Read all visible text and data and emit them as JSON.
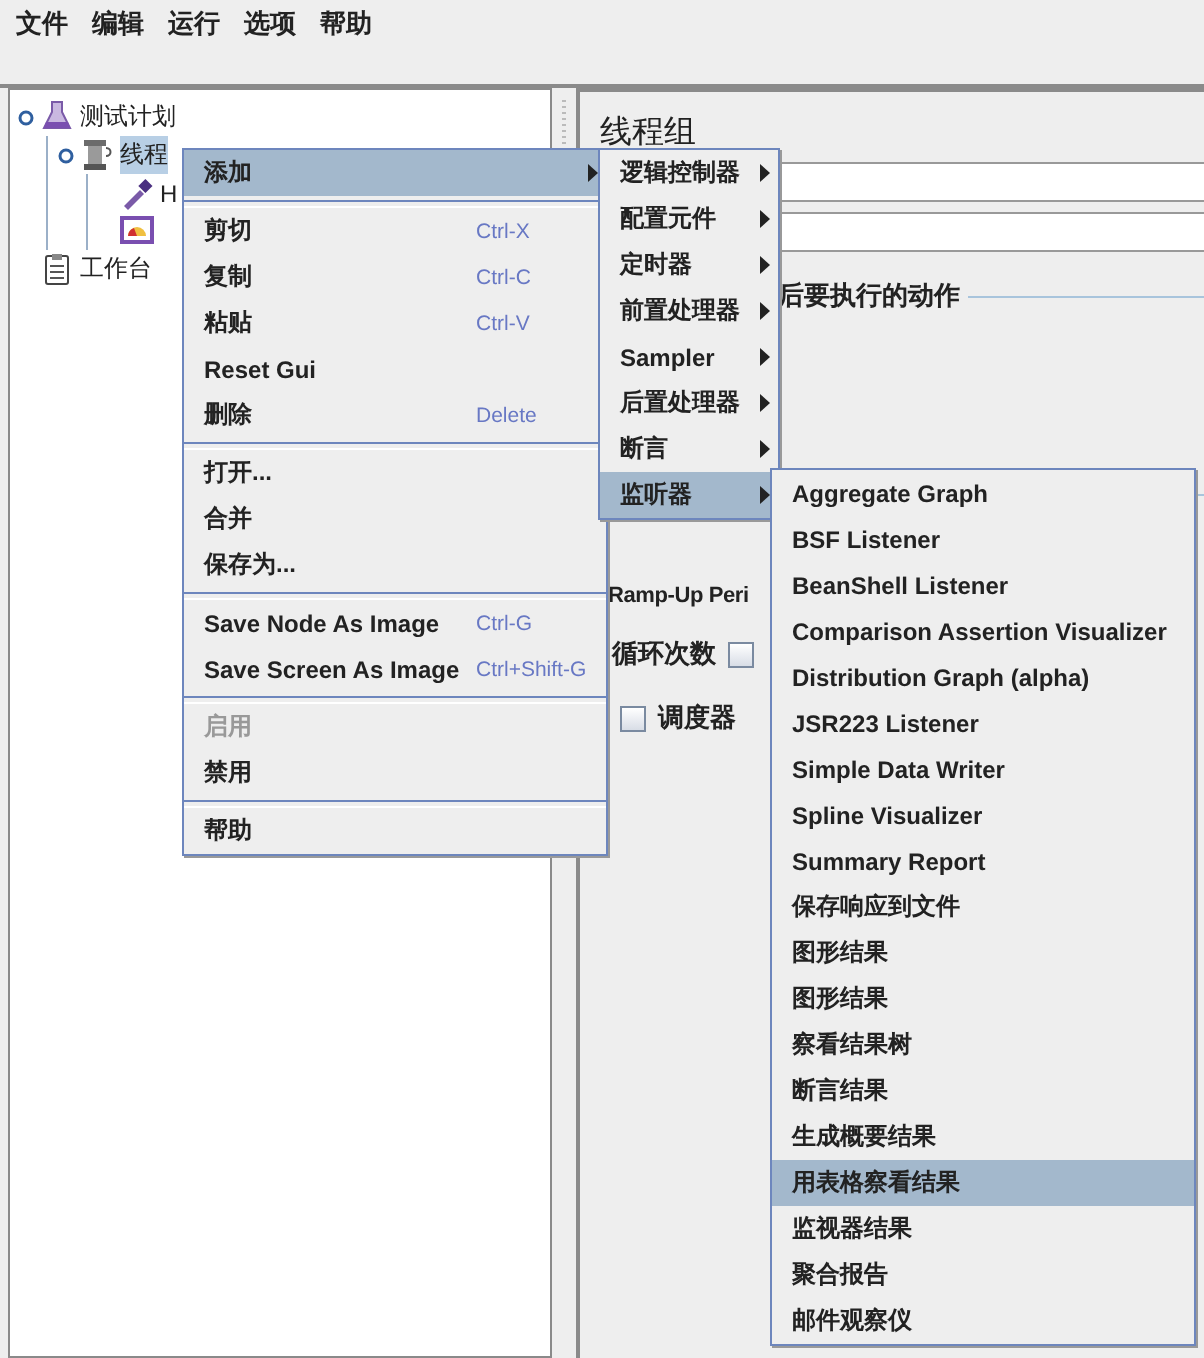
{
  "menu_bar": [
    {
      "label": "文件"
    },
    {
      "label": "编辑"
    },
    {
      "label": "运行"
    },
    {
      "label": "选项"
    },
    {
      "label": "帮助"
    }
  ],
  "tree": [
    {
      "label": "测试计划",
      "kind": "flask",
      "selected": false,
      "children": [
        {
          "label": "线程",
          "kind": "spool",
          "selected": true,
          "children": [
            {
              "label": "H",
              "kind": "dropper",
              "selected": false
            },
            {
              "kind": "gauge"
            }
          ]
        }
      ]
    },
    {
      "label": "工作台",
      "kind": "clipboard",
      "selected": false
    }
  ],
  "thread_group": {
    "title": "线程组",
    "error_action_label": "后要执行的动作",
    "ramp_up_label": "Ramp-Up Peri",
    "loop_label": "循环次数",
    "loop_checkbox": {
      "checked": false
    },
    "scheduler": {
      "label": "调度器",
      "checked": false
    }
  },
  "context_menu": {
    "items": [
      {
        "kind": "item",
        "label": "添加",
        "selected": true,
        "disabled": false,
        "submenu": true
      },
      {
        "kind": "separator"
      },
      {
        "kind": "item",
        "label": "剪切",
        "shortcut": "Ctrl-X",
        "selected": false,
        "disabled": false,
        "submenu": false
      },
      {
        "kind": "item",
        "label": "复制",
        "shortcut": "Ctrl-C",
        "selected": false,
        "disabled": false,
        "submenu": false
      },
      {
        "kind": "item",
        "label": "粘贴",
        "shortcut": "Ctrl-V",
        "selected": false,
        "disabled": false,
        "submenu": false
      },
      {
        "kind": "item",
        "label": "Reset Gui",
        "selected": false,
        "disabled": false,
        "submenu": false
      },
      {
        "kind": "item",
        "label": "删除",
        "shortcut": "Delete",
        "selected": false,
        "disabled": false,
        "submenu": false
      },
      {
        "kind": "separator"
      },
      {
        "kind": "item",
        "label": "打开...",
        "selected": false,
        "disabled": false,
        "submenu": false
      },
      {
        "kind": "item",
        "label": "合并",
        "selected": false,
        "disabled": false,
        "submenu": false
      },
      {
        "kind": "item",
        "label": "保存为...",
        "selected": false,
        "disabled": false,
        "submenu": false
      },
      {
        "kind": "separator"
      },
      {
        "kind": "item",
        "label": "Save Node As Image",
        "shortcut": "Ctrl-G",
        "selected": false,
        "disabled": false,
        "submenu": false
      },
      {
        "kind": "item",
        "label": "Save Screen As Image",
        "shortcut": "Ctrl+Shift-G",
        "selected": false,
        "disabled": false,
        "submenu": false
      },
      {
        "kind": "separator"
      },
      {
        "kind": "item",
        "label": "启用",
        "selected": false,
        "disabled": true,
        "submenu": false
      },
      {
        "kind": "item",
        "label": "禁用",
        "selected": false,
        "disabled": false,
        "submenu": false
      },
      {
        "kind": "separator"
      },
      {
        "kind": "item",
        "label": "帮助",
        "selected": false,
        "disabled": false,
        "submenu": false
      }
    ]
  },
  "add_menu": {
    "items": [
      {
        "kind": "item",
        "label": "逻辑控制器",
        "selected": false,
        "submenu": true
      },
      {
        "kind": "item",
        "label": "配置元件",
        "selected": false,
        "submenu": true
      },
      {
        "kind": "item",
        "label": "定时器",
        "selected": false,
        "submenu": true
      },
      {
        "kind": "item",
        "label": "前置处理器",
        "selected": false,
        "submenu": true
      },
      {
        "kind": "item",
        "label": "Sampler",
        "selected": false,
        "submenu": true
      },
      {
        "kind": "item",
        "label": "后置处理器",
        "selected": false,
        "submenu": true
      },
      {
        "kind": "item",
        "label": "断言",
        "selected": false,
        "submenu": true
      },
      {
        "kind": "item",
        "label": "监听器",
        "selected": true,
        "submenu": true
      }
    ]
  },
  "listener_menu": {
    "items": [
      {
        "kind": "item",
        "label": "Aggregate Graph",
        "selected": false
      },
      {
        "kind": "item",
        "label": "BSF Listener",
        "selected": false
      },
      {
        "kind": "item",
        "label": "BeanShell Listener",
        "selected": false
      },
      {
        "kind": "item",
        "label": "Comparison Assertion Visualizer",
        "selected": false
      },
      {
        "kind": "item",
        "label": "Distribution Graph (alpha)",
        "selected": false
      },
      {
        "kind": "item",
        "label": "JSR223 Listener",
        "selected": false
      },
      {
        "kind": "item",
        "label": "Simple Data Writer",
        "selected": false
      },
      {
        "kind": "item",
        "label": "Spline Visualizer",
        "selected": false
      },
      {
        "kind": "item",
        "label": "Summary Report",
        "selected": false
      },
      {
        "kind": "item",
        "label": "保存响应到文件",
        "selected": false
      },
      {
        "kind": "item",
        "label": "图形结果",
        "selected": false
      },
      {
        "kind": "item",
        "label": "图形结果",
        "selected": false
      },
      {
        "kind": "item",
        "label": "察看结果树",
        "selected": false
      },
      {
        "kind": "item",
        "label": "断言结果",
        "selected": false
      },
      {
        "kind": "item",
        "label": "生成概要结果",
        "selected": false
      },
      {
        "kind": "item",
        "label": "用表格察看结果",
        "selected": true
      },
      {
        "kind": "item",
        "label": "监视器结果",
        "selected": false
      },
      {
        "kind": "item",
        "label": "聚合报告",
        "selected": false
      },
      {
        "kind": "item",
        "label": "邮件观察仪",
        "selected": false
      }
    ]
  }
}
